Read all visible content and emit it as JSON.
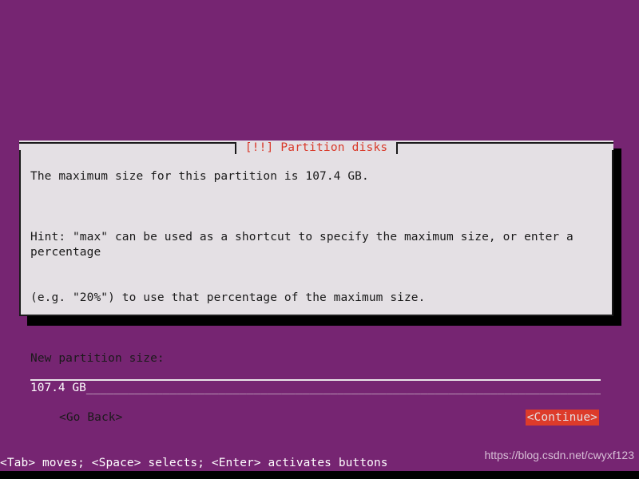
{
  "screen": {
    "background_color": "#762572",
    "foreground_color": "#ffffff"
  },
  "dialog": {
    "title": "[!!] Partition disks",
    "title_color": "#d9392a",
    "background_color": "#e4e0e4",
    "text_color": "#1a1a1a",
    "paragraphs": {
      "max_size": "The maximum size for this partition is 107.4 GB.",
      "hint_line1": "Hint: \"max\" can be used as a shortcut to specify the maximum size, or enter a percentage",
      "hint_line2": "(e.g. \"20%\") to use that percentage of the maximum size."
    },
    "field": {
      "label": "New partition size:",
      "value": "107.4 GB",
      "placeholder": "107.4 GB",
      "fill": "_______________________________________________________________________________",
      "background_color": "#762572",
      "value_color": "#ffffff"
    },
    "buttons": {
      "go_back": "<Go Back>",
      "continue": "<Continue>",
      "selected": "<Continue>",
      "selected_background_color": "#dd3b2a",
      "selected_text_color": "#e4e0e4"
    }
  },
  "statusbar": {
    "hint": "<Tab> moves; <Space> selects; <Enter> activates buttons"
  },
  "watermark": {
    "text": "https://blog.csdn.net/cwyxf123"
  }
}
